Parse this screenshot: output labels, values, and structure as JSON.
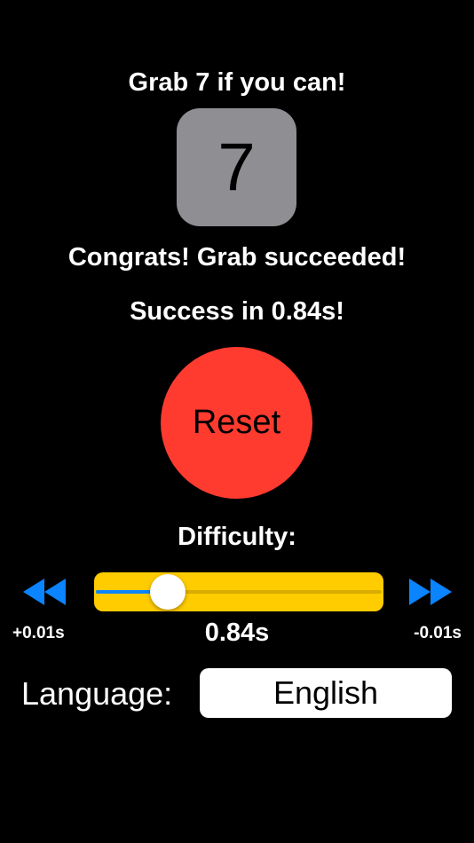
{
  "header": {
    "title": "Grab 7 if you can!"
  },
  "target_tile": {
    "value": "7"
  },
  "messages": {
    "status": "Congrats! Grab succeeded!",
    "time": "Success in 0.84s!"
  },
  "controls": {
    "reset_label": "Reset",
    "difficulty_label": "Difficulty:"
  },
  "difficulty": {
    "value_label": "0.84s",
    "left_step_label": "+0.01s",
    "right_step_label": "-0.01s",
    "slider_fraction": 0.25,
    "decrease_icon": "rewind-icon",
    "increase_icon": "fast-forward-icon"
  },
  "language": {
    "label": "Language:",
    "selected": "English"
  },
  "colors": {
    "background": "#000000",
    "tile": "#8e8e93",
    "reset": "#ff3b30",
    "slider_track": "#ffcc00",
    "slider_fill": "#0a84ff",
    "icon_blue": "#0a84ff"
  }
}
